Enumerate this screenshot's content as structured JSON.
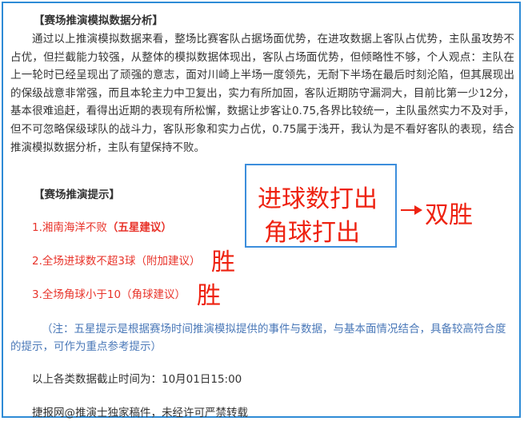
{
  "article": {
    "heading_analysis": "【赛场推演模拟数据分析】",
    "analysis_paragraph": "通过以上推演模拟数据来看，整场比赛客队占据场面优势，在进攻数据上客队占优势，主队虽攻势不占优，但拦截能力较强，从整体的模拟数据体现出，客队占场面优势，但倾略性不够，个人观点：主队在上一轮时已经呈现出了顽强的意志，面对川崎上半场一度领先，无耐下半场在最后时刻沦陷，但其展现出的保级战意非常强，而且本轮主力中卫复出，实力有所加固，客队近期防守漏洞大，目前比第一少12分，基本很难追赶，看得出近期的表现有所松懈，数据让步客让0.75,各界比较统一，主队虽然实力不及对手，但不可忽略保级球队的战斗力，客队形象和实力占优，0.75属于浅开，我认为是不看好客队的表现，结合推演模拟数据分析，主队有望保持不败。",
    "heading_tips": "【赛场推演提示】",
    "tip1_text": "1.湘南海洋不败",
    "tip1_suffix": "（五星建议）",
    "tip2_text": "2.全场进球数不超3球（附加建议）",
    "tip3_text": "3.全场角球小于10（角球建议）",
    "note": "（注：五星提示是根据赛场时间推演模拟提供的事件与数据，与基本面情况结合，具备较高符合度的提示，可作为重点参考提示）",
    "deadline": "以上各类数据截止时间为：10月01日15:00",
    "copyright": "捷报网@推演士独家稿件，未经许可严禁转载"
  },
  "annotations": {
    "mark_tip2": "胜",
    "mark_tip3": "胜",
    "callout_line1": "进球数打出",
    "callout_line2": "角球打出",
    "callout_result": "双胜"
  },
  "colors": {
    "border": "#2e8bd6",
    "tip_red": "#e8332a",
    "note_blue": "#4a78b8",
    "handwriting_red": "#ee2211"
  }
}
